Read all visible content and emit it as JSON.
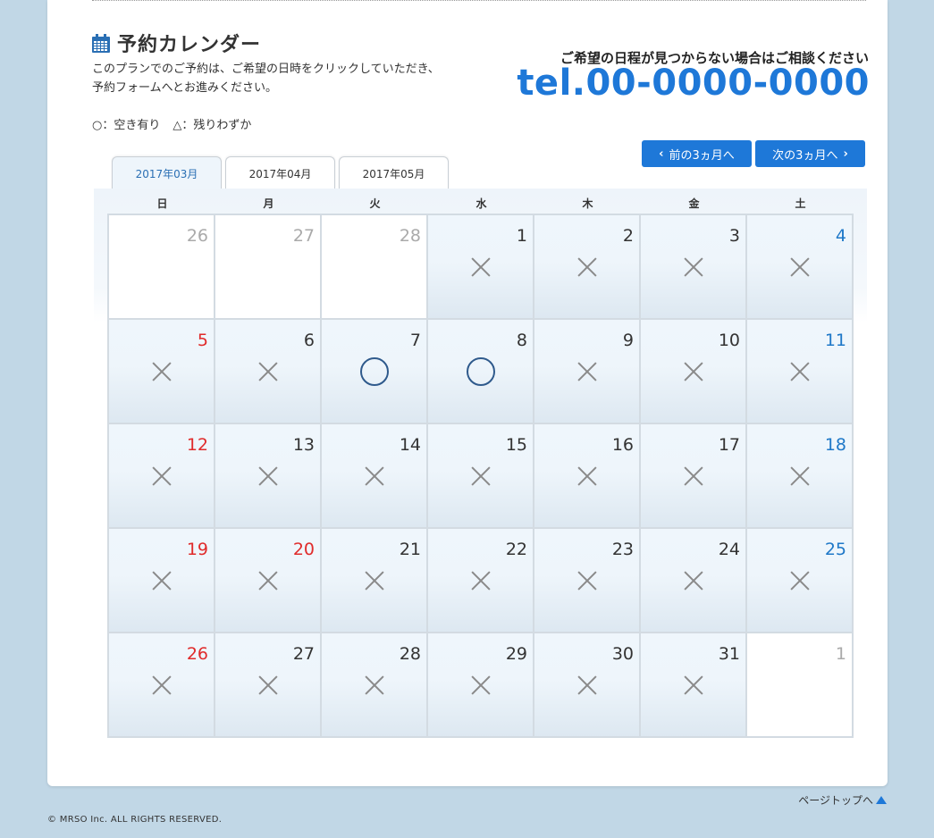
{
  "header": {
    "title": "予約カレンダー",
    "intro_line1": "このプランでのご予約は、ご希望の日時をクリックしていただき、",
    "intro_line2": "予約フォームへとお進みください。"
  },
  "legend": {
    "available": "○：空き有り",
    "few_left": "△：残りわずか"
  },
  "contact": {
    "question": "ご希望の日程が見つからない場合はご相談ください",
    "tel": "tel.00-0000-0000"
  },
  "nav": {
    "prev_label": "前の3ヵ月へ",
    "next_label": "次の3ヵ月へ",
    "prev_icon": "chevron-left-icon",
    "next_icon": "chevron-right-icon"
  },
  "tabs": [
    {
      "label": "2017年03月",
      "active": true
    },
    {
      "label": "2017年04月",
      "active": false
    },
    {
      "label": "2017年05月",
      "active": false
    }
  ],
  "weekdays": [
    "日",
    "月",
    "火",
    "水",
    "木",
    "金",
    "土"
  ],
  "weeks": [
    [
      {
        "day": "26",
        "type": "gray",
        "mark": ""
      },
      {
        "day": "27",
        "type": "gray",
        "mark": ""
      },
      {
        "day": "28",
        "type": "gray",
        "mark": ""
      },
      {
        "day": "1",
        "type": "normal",
        "mark": "x"
      },
      {
        "day": "2",
        "type": "normal",
        "mark": "x"
      },
      {
        "day": "3",
        "type": "normal",
        "mark": "x"
      },
      {
        "day": "4",
        "type": "sat",
        "mark": "x"
      }
    ],
    [
      {
        "day": "5",
        "type": "sun",
        "mark": "x"
      },
      {
        "day": "6",
        "type": "normal",
        "mark": "x"
      },
      {
        "day": "7",
        "type": "normal",
        "mark": "o"
      },
      {
        "day": "8",
        "type": "normal",
        "mark": "o"
      },
      {
        "day": "9",
        "type": "normal",
        "mark": "x"
      },
      {
        "day": "10",
        "type": "normal",
        "mark": "x"
      },
      {
        "day": "11",
        "type": "sat",
        "mark": "x"
      }
    ],
    [
      {
        "day": "12",
        "type": "sun",
        "mark": "x"
      },
      {
        "day": "13",
        "type": "normal",
        "mark": "x"
      },
      {
        "day": "14",
        "type": "normal",
        "mark": "x"
      },
      {
        "day": "15",
        "type": "normal",
        "mark": "x"
      },
      {
        "day": "16",
        "type": "normal",
        "mark": "x"
      },
      {
        "day": "17",
        "type": "normal",
        "mark": "x"
      },
      {
        "day": "18",
        "type": "sat",
        "mark": "x"
      }
    ],
    [
      {
        "day": "19",
        "type": "sun",
        "mark": "x"
      },
      {
        "day": "20",
        "type": "sun",
        "mark": "x"
      },
      {
        "day": "21",
        "type": "normal",
        "mark": "x"
      },
      {
        "day": "22",
        "type": "normal",
        "mark": "x"
      },
      {
        "day": "23",
        "type": "normal",
        "mark": "x"
      },
      {
        "day": "24",
        "type": "normal",
        "mark": "x"
      },
      {
        "day": "25",
        "type": "sat",
        "mark": "x"
      }
    ],
    [
      {
        "day": "26",
        "type": "sun",
        "mark": "x"
      },
      {
        "day": "27",
        "type": "normal",
        "mark": "x"
      },
      {
        "day": "28",
        "type": "normal",
        "mark": "x"
      },
      {
        "day": "29",
        "type": "normal",
        "mark": "x"
      },
      {
        "day": "30",
        "type": "normal",
        "mark": "x"
      },
      {
        "day": "31",
        "type": "normal",
        "mark": "x"
      },
      {
        "day": "1",
        "type": "gray",
        "mark": ""
      }
    ]
  ],
  "footer": {
    "page_top": "ページトップへ",
    "copyright": "© MRSO Inc. ALL RIGHTS RESERVED."
  },
  "colors": {
    "accent": "#1e78d8",
    "sunday": "#e02b2b",
    "saturday": "#1e78c8",
    "background": "#c1d7e6"
  }
}
